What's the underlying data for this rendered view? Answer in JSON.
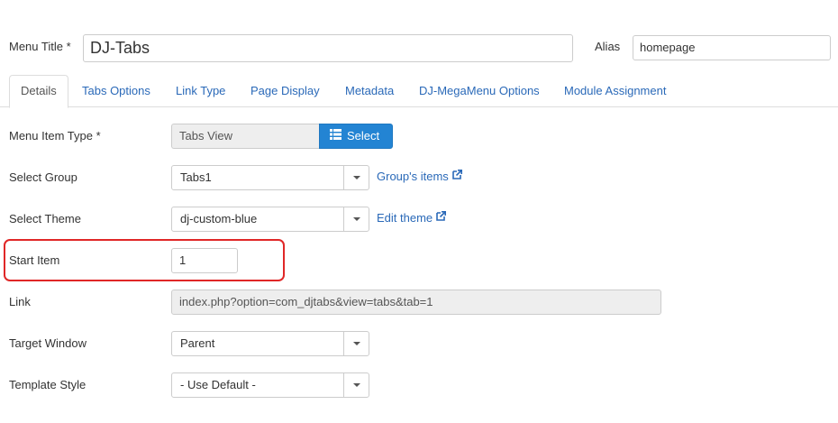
{
  "header": {
    "menu_title_label": "Menu Title *",
    "menu_title_value": "DJ-Tabs",
    "alias_label": "Alias",
    "alias_value": "homepage"
  },
  "tabs": [
    {
      "label": "Details",
      "active": true
    },
    {
      "label": "Tabs Options",
      "active": false
    },
    {
      "label": "Link Type",
      "active": false
    },
    {
      "label": "Page Display",
      "active": false
    },
    {
      "label": "Metadata",
      "active": false
    },
    {
      "label": "DJ-MegaMenu Options",
      "active": false
    },
    {
      "label": "Module Assignment",
      "active": false
    }
  ],
  "form": {
    "menu_item_type": {
      "label": "Menu Item Type *",
      "value": "Tabs View",
      "button_label": "Select",
      "button_icon": "list-icon"
    },
    "select_group": {
      "label": "Select Group",
      "value": "Tabs1",
      "link_label": "Group's items",
      "link_icon": "external-link-icon"
    },
    "select_theme": {
      "label": "Select Theme",
      "value": "dj-custom-blue",
      "link_label": "Edit theme",
      "link_icon": "external-link-icon"
    },
    "start_item": {
      "label": "Start Item",
      "value": "1"
    },
    "link": {
      "label": "Link",
      "value": "index.php?option=com_djtabs&view=tabs&tab=1"
    },
    "target_window": {
      "label": "Target Window",
      "value": "Parent"
    },
    "template_style": {
      "label": "Template Style",
      "value": "- Use Default -"
    }
  },
  "colors": {
    "accent": "#2384d3",
    "link": "#2a69b8",
    "highlight": "#e02727"
  }
}
